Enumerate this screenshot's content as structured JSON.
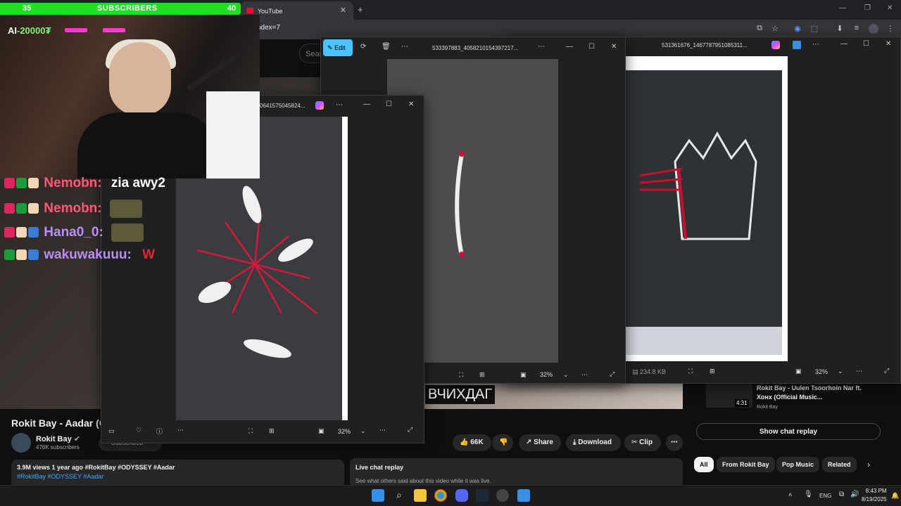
{
  "browser": {
    "tab_title": "YouTube",
    "url_fragment": "ndex=7",
    "new_tab_label": "+"
  },
  "youtube": {
    "search_placeholder": "Sear",
    "video_caption": "ВЧИХДАГ",
    "video_title": "Rokit Bay - Aadar (Of",
    "channel_name": "Rokit Bay",
    "channel_subs": "476K subscribers",
    "subscribe_label": "Subscribed",
    "likes": "66K",
    "share_label": "Share",
    "download_label": "Download",
    "clip_label": "Clip",
    "desc_line1": "3.9M views  1 year ago  #RokitBay #ODYSSEY #Aadar",
    "desc_line2": "#RokitBay #ODYSSEY #Aadar",
    "live_chat_title": "Live chat replay",
    "live_chat_sub": "See what others said about this video while it was live.",
    "related": {
      "title": "Rokit Bay - Uulen Tsoorhoin Nar ft. Хонх (Official Music...",
      "channel": "Rokit Bay",
      "duration": "4:31"
    },
    "show_chat_label": "Show chat replay",
    "chips": [
      "All",
      "From Rokit Bay",
      "Pop Music",
      "Related"
    ]
  },
  "photo_windows": [
    {
      "title": "0641575045824...",
      "zoom": "32%"
    },
    {
      "title": "533397883_4058210154397217...",
      "edit_label": "Edit",
      "zoom": "32%"
    },
    {
      "title": "531361676_1467787951085311...",
      "file_size": "234.8 KB",
      "zoom": "32%"
    }
  ],
  "overlay": {
    "sub_current": "35",
    "sub_label": "SUBSCRIBERS",
    "sub_goal": "40",
    "ai_label": "AI",
    "ai_amount": "-20000₮",
    "chat": [
      {
        "user": "Nemobn:",
        "message": "zia awy2",
        "color": "#ff5a7a"
      },
      {
        "user": "Nemobn:",
        "message": "",
        "color": "#ff5a7a"
      },
      {
        "user": "Hana0_0:",
        "message": "",
        "color": "#b98cff"
      },
      {
        "user": "wakuwakuuu:",
        "message": "W",
        "color": "#b98cff"
      }
    ]
  },
  "taskbar": {
    "lang": "ENG",
    "time": "8:43 PM",
    "date": "8/19/2025"
  }
}
